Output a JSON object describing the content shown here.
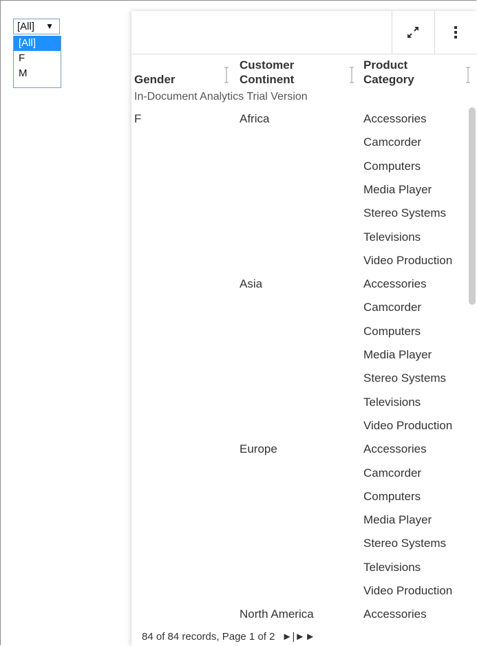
{
  "filter": {
    "selected": "[All]",
    "arrow": "▼",
    "options": [
      "[All]",
      "F",
      "M"
    ]
  },
  "table": {
    "headers": {
      "gender": "Gender",
      "continent_line1": "Customer",
      "continent_line2": "Continent",
      "category_line1": "Product",
      "category_line2": "Category"
    },
    "trial_note": "In-Document Analytics Trial Version",
    "rows": [
      {
        "gender": "F",
        "continent": "Africa",
        "category": "Accessories"
      },
      {
        "gender": "",
        "continent": "",
        "category": "Camcorder"
      },
      {
        "gender": "",
        "continent": "",
        "category": "Computers"
      },
      {
        "gender": "",
        "continent": "",
        "category": "Media Player"
      },
      {
        "gender": "",
        "continent": "",
        "category": "Stereo Systems"
      },
      {
        "gender": "",
        "continent": "",
        "category": "Televisions"
      },
      {
        "gender": "",
        "continent": "",
        "category": "Video Production"
      },
      {
        "gender": "",
        "continent": "Asia",
        "category": "Accessories"
      },
      {
        "gender": "",
        "continent": "",
        "category": "Camcorder"
      },
      {
        "gender": "",
        "continent": "",
        "category": "Computers"
      },
      {
        "gender": "",
        "continent": "",
        "category": "Media Player"
      },
      {
        "gender": "",
        "continent": "",
        "category": "Stereo Systems"
      },
      {
        "gender": "",
        "continent": "",
        "category": "Televisions"
      },
      {
        "gender": "",
        "continent": "",
        "category": "Video Production"
      },
      {
        "gender": "",
        "continent": "Europe",
        "category": "Accessories"
      },
      {
        "gender": "",
        "continent": "",
        "category": "Camcorder"
      },
      {
        "gender": "",
        "continent": "",
        "category": "Computers"
      },
      {
        "gender": "",
        "continent": "",
        "category": "Media Player"
      },
      {
        "gender": "",
        "continent": "",
        "category": "Stereo Systems"
      },
      {
        "gender": "",
        "continent": "",
        "category": "Televisions"
      },
      {
        "gender": "",
        "continent": "",
        "category": "Video Production"
      },
      {
        "gender": "",
        "continent": "North America",
        "category": "Accessories"
      }
    ]
  },
  "footer": {
    "records_text": "84 of 84 records, Page 1 of 2",
    "pager_text": "►|►►"
  },
  "icons": {
    "expand": "expand-icon",
    "more": "more-vertical-icon",
    "sort": "sort-icon"
  }
}
